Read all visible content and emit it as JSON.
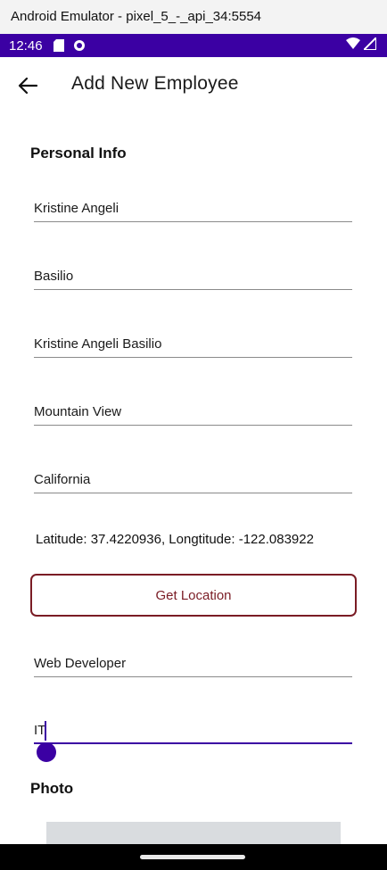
{
  "window": {
    "title": "Android Emulator - pixel_5_-_api_34:5554"
  },
  "status_bar": {
    "time": "12:46",
    "icons_left": [
      "sd-card-icon",
      "app-notification-icon"
    ],
    "icons_right": [
      "wifi-icon",
      "signal-icon"
    ]
  },
  "app_bar": {
    "back_icon": "arrow-left-icon",
    "title": "Add New Employee"
  },
  "personal_info": {
    "section_title": "Personal Info",
    "first_name": "Kristine Angeli",
    "last_name": "Basilio",
    "full_name": "Kristine Angeli Basilio",
    "city": "Mountain View",
    "state": "California",
    "coordinates_text": "Latitude: 37.4220936, Longtitude: -122.083922",
    "get_location_label": "Get Location",
    "position": "Web Developer",
    "department": "IT"
  },
  "photo": {
    "section_title": "Photo"
  },
  "colors": {
    "status_bar": "#3b00a3",
    "accent": "#3b00a3",
    "button_border": "#7a1c25"
  }
}
